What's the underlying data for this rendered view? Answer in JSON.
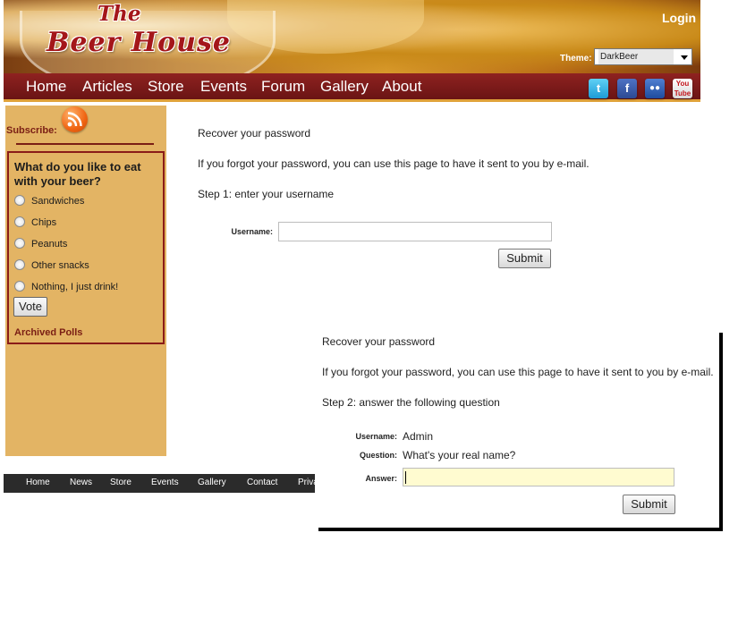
{
  "header": {
    "logo_line1": "The",
    "logo_line2": "Beer House",
    "login": "Login",
    "theme_label": "Theme:",
    "theme_selected": "DarkBeer"
  },
  "nav": {
    "items": [
      "Home",
      "Articles",
      "Store",
      "Events",
      "Forum",
      "Gallery",
      "About"
    ],
    "social_icons": [
      "twitter-icon",
      "facebook-icon",
      "myspace-icon",
      "youtube-icon"
    ]
  },
  "sidebar": {
    "subscribe": "Subscribe:",
    "poll": {
      "question": "What do you like to eat with your beer?",
      "options": [
        "Sandwiches",
        "Chips",
        "Peanuts",
        "Other snacks",
        "Nothing, I just drink!"
      ],
      "vote": "Vote",
      "archived": "Archived Polls"
    }
  },
  "footer": {
    "items": [
      "Home",
      "News",
      "Store",
      "Events",
      "Gallery",
      "Contact",
      "Privacy"
    ]
  },
  "step1": {
    "title": "Recover your password",
    "intro": "If you forgot your password, you can use this page to have it sent to you by e-mail.",
    "step": "Step 1: enter your username",
    "username_label": "Username:",
    "submit": "Submit"
  },
  "step2": {
    "title": "Recover your password",
    "intro": "If you forgot your password, you can use this page to have it sent to you by e-mail.",
    "step": "Step 2: answer the following question",
    "username_label": "Username:",
    "username_value": "Admin",
    "question_label": "Question:",
    "question_value": "What's your real name?",
    "answer_label": "Answer:",
    "submit": "Submit"
  },
  "colors": {
    "nav_bg": "#7a1a18",
    "sidebar_bg": "#e3b464",
    "poll_border": "#8a1c18",
    "answer_bg": "#fffbd0"
  }
}
